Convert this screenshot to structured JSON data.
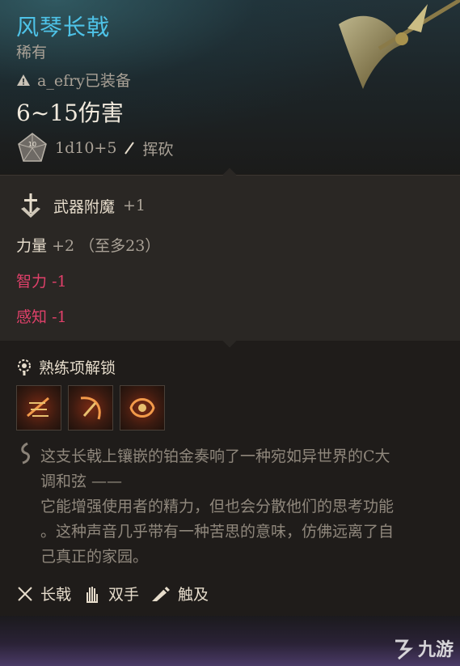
{
  "item": {
    "name": "风琴长戟",
    "rarity": "稀有",
    "equipped_by": "a_efry已装备",
    "damage": "6~15伤害",
    "dice": "1d10+5",
    "damage_type": "挥砍",
    "die_face": "10"
  },
  "enchant": {
    "label": "武器附魔",
    "value": "+1"
  },
  "stats": [
    {
      "name": "力量",
      "value": "+2 （至多23）",
      "kind": "positive"
    },
    {
      "name": "智力",
      "value": "-1",
      "kind": "negative"
    },
    {
      "name": "感知",
      "value": "-1",
      "kind": "negative"
    }
  ],
  "proficiency": {
    "title": "熟练项解锁",
    "icons": [
      "weapon-action-icon-1",
      "weapon-action-icon-2",
      "weapon-action-icon-3"
    ]
  },
  "lore": {
    "lines": [
      "这支长戟上镶嵌的铂金奏响了一种宛如异世界的C大",
      "调和弦 ——",
      "它能增强使用者的精力，但也会分散他们的思考功能",
      "。这种声音几乎带有一种苦思的意味，仿佛远离了自",
      "己真正的家园。"
    ]
  },
  "tags": [
    {
      "label": "长戟",
      "icon": "crossed-weapons-icon"
    },
    {
      "label": "双手",
      "icon": "hand-icon"
    },
    {
      "label": "触及",
      "icon": "reach-icon"
    }
  ],
  "watermark": {
    "text": "九游"
  },
  "colors": {
    "title": "#4ec3e8",
    "negative": "#e0406a",
    "text": "#e6dccb",
    "muted": "#a9a196"
  }
}
